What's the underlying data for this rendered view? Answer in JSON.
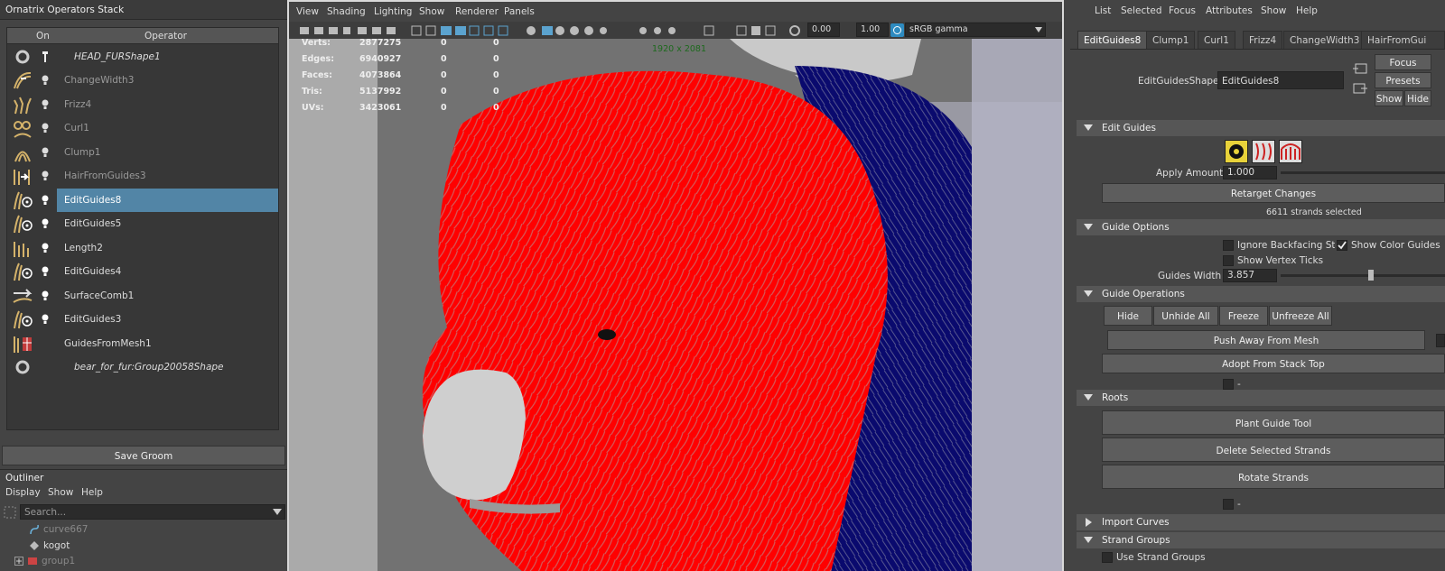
{
  "stack": {
    "title": "Ornatrix Operators Stack",
    "col_on": "On",
    "col_operator": "Operator",
    "operators": [
      {
        "name": "HEAD_FURShape1"
      },
      {
        "name": "ChangeWidth3"
      },
      {
        "name": "Frizz4"
      },
      {
        "name": "Curl1"
      },
      {
        "name": "Clump1"
      },
      {
        "name": "HairFromGuides3"
      },
      {
        "name": "EditGuides8"
      },
      {
        "name": "EditGuides5"
      },
      {
        "name": "Length2"
      },
      {
        "name": "EditGuides4"
      },
      {
        "name": "SurfaceComb1"
      },
      {
        "name": "EditGuides3"
      },
      {
        "name": "GuidesFromMesh1"
      },
      {
        "name": "bear_for_fur:Group20058Shape"
      }
    ],
    "save_label": "Save Groom"
  },
  "outliner": {
    "title": "Outliner",
    "menu": [
      "Display",
      "Show",
      "Help"
    ],
    "search_placeholder": "Search...",
    "items": [
      "curve667",
      "kogot",
      "group1"
    ]
  },
  "viewport": {
    "menu": [
      "View",
      "Shading",
      "Lighting",
      "Show",
      "Renderer",
      "Panels"
    ],
    "field1": "0.00",
    "field2": "1.00",
    "color_space": "sRGB gamma",
    "resolution": "1920 x 2081",
    "stats": [
      {
        "label": "Verts:",
        "v1": "2877275",
        "v2": "0",
        "v3": "0"
      },
      {
        "label": "Edges:",
        "v1": "6940927",
        "v2": "0",
        "v3": "0"
      },
      {
        "label": "Faces:",
        "v1": "4073864",
        "v2": "0",
        "v3": "0"
      },
      {
        "label": "Tris:",
        "v1": "5137992",
        "v2": "0",
        "v3": "0"
      },
      {
        "label": "UVs:",
        "v1": "3423061",
        "v2": "0",
        "v3": "0"
      }
    ]
  },
  "ae": {
    "menu": [
      "List",
      "Selected",
      "Focus",
      "Attributes",
      "Show",
      "Help"
    ],
    "tabs": [
      "EditGuides8",
      "Clump1",
      "Curl1",
      "Frizz4",
      "ChangeWidth3",
      "HairFromGui"
    ],
    "shape_label": "EditGuidesShape:",
    "shape_value": "EditGuides8",
    "focus": "Focus",
    "presets": "Presets",
    "show": "Show",
    "hide": "Hide",
    "edit_guides": "Edit Guides",
    "apply_amount_label": "Apply Amount",
    "apply_amount": "1.000",
    "retarget": "Retarget Changes",
    "strands_selected": "6611 strands selected",
    "guide_options": "Guide Options",
    "ignore_backfacing": "Ignore Backfacing Stra",
    "show_color_guides": "Show Color Guides",
    "show_vertex_ticks": "Show Vertex Ticks",
    "guides_width_label": "Guides Width",
    "guides_width": "3.857",
    "guide_operations": "Guide Operations",
    "op_hide": "Hide",
    "op_unhide_all": "Unhide All",
    "op_freeze": "Freeze",
    "op_unfreeze_all": "Unfreeze All",
    "push_away": "Push Away From Mesh",
    "adopt": "Adopt From Stack Top",
    "dash1": "-",
    "roots": "Roots",
    "plant": "Plant Guide Tool",
    "delete_strands": "Delete Selected Strands",
    "rotate_strands": "Rotate Strands",
    "dash2": "-",
    "import_curves": "Import Curves",
    "strand_groups": "Strand Groups",
    "use_strand_groups": "Use Strand Groups"
  }
}
